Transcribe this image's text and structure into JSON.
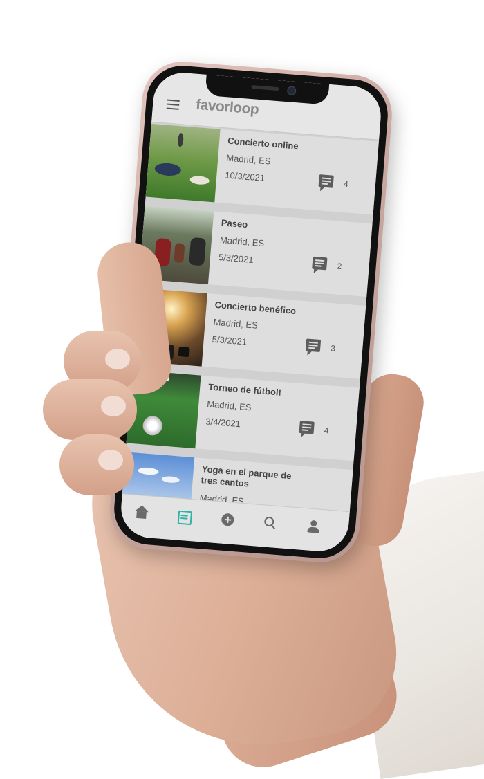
{
  "app": {
    "logo": "favorloop"
  },
  "events": [
    {
      "title": "Concierto online",
      "location": "Madrid, ES",
      "date": "10/3/2021",
      "comments": "4",
      "thumb": "t1"
    },
    {
      "title": "Paseo",
      "location": "Madrid, ES",
      "date": "5/3/2021",
      "comments": "2",
      "thumb": "t2"
    },
    {
      "title": "Concierto benéfico",
      "location": "Madrid, ES",
      "date": "5/3/2021",
      "comments": "3",
      "thumb": "t3"
    },
    {
      "title": "Torneo de fútbol!",
      "location": "Madrid, ES",
      "date": "3/4/2021",
      "comments": "4",
      "thumb": "t4"
    },
    {
      "title": "Yoga en el parque de tres cantos",
      "location": "Madrid, ES",
      "date": "",
      "comments": "",
      "thumb": "t5"
    }
  ],
  "nav": [
    "home-icon",
    "calendar-icon",
    "add-icon",
    "search-icon",
    "user-icon"
  ],
  "colors": {
    "accent": "#2fb3a5",
    "background": "#d0d0d0",
    "card": "#dedede"
  }
}
